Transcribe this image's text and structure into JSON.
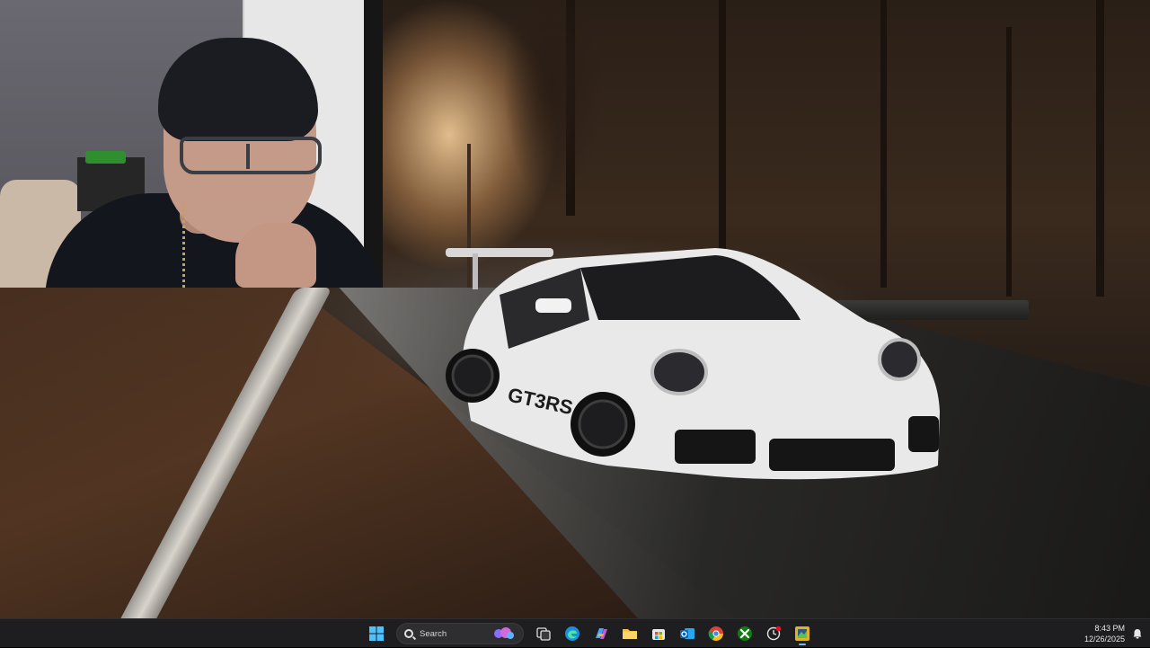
{
  "wallpaper": {
    "subject": "white sports car on a forest road at sunset",
    "car_badge_text": "GT3RS"
  },
  "webcam_overlay": {
    "visible": true
  },
  "taskbar": {
    "search_label": "Search",
    "pinned_apps": [
      {
        "name": "start",
        "icon": "windows-logo-icon"
      },
      {
        "name": "search",
        "icon": "search-icon"
      },
      {
        "name": "task-view",
        "icon": "task-view-icon"
      },
      {
        "name": "edge",
        "icon": "edge-icon"
      },
      {
        "name": "copilot",
        "icon": "copilot-icon"
      },
      {
        "name": "file-explorer",
        "icon": "folder-icon"
      },
      {
        "name": "microsoft-store",
        "icon": "store-icon"
      },
      {
        "name": "outlook",
        "icon": "outlook-icon"
      },
      {
        "name": "chrome",
        "icon": "chrome-icon"
      },
      {
        "name": "xbox",
        "icon": "xbox-icon"
      },
      {
        "name": "steam-like",
        "icon": "clock-app-icon"
      },
      {
        "name": "active-app",
        "icon": "app-yellow-icon"
      }
    ],
    "clock": {
      "time": "8:43 PM",
      "date": "12/26/2025"
    }
  },
  "colors": {
    "taskbar_bg": "#202022",
    "accent": "#76b9ed"
  }
}
